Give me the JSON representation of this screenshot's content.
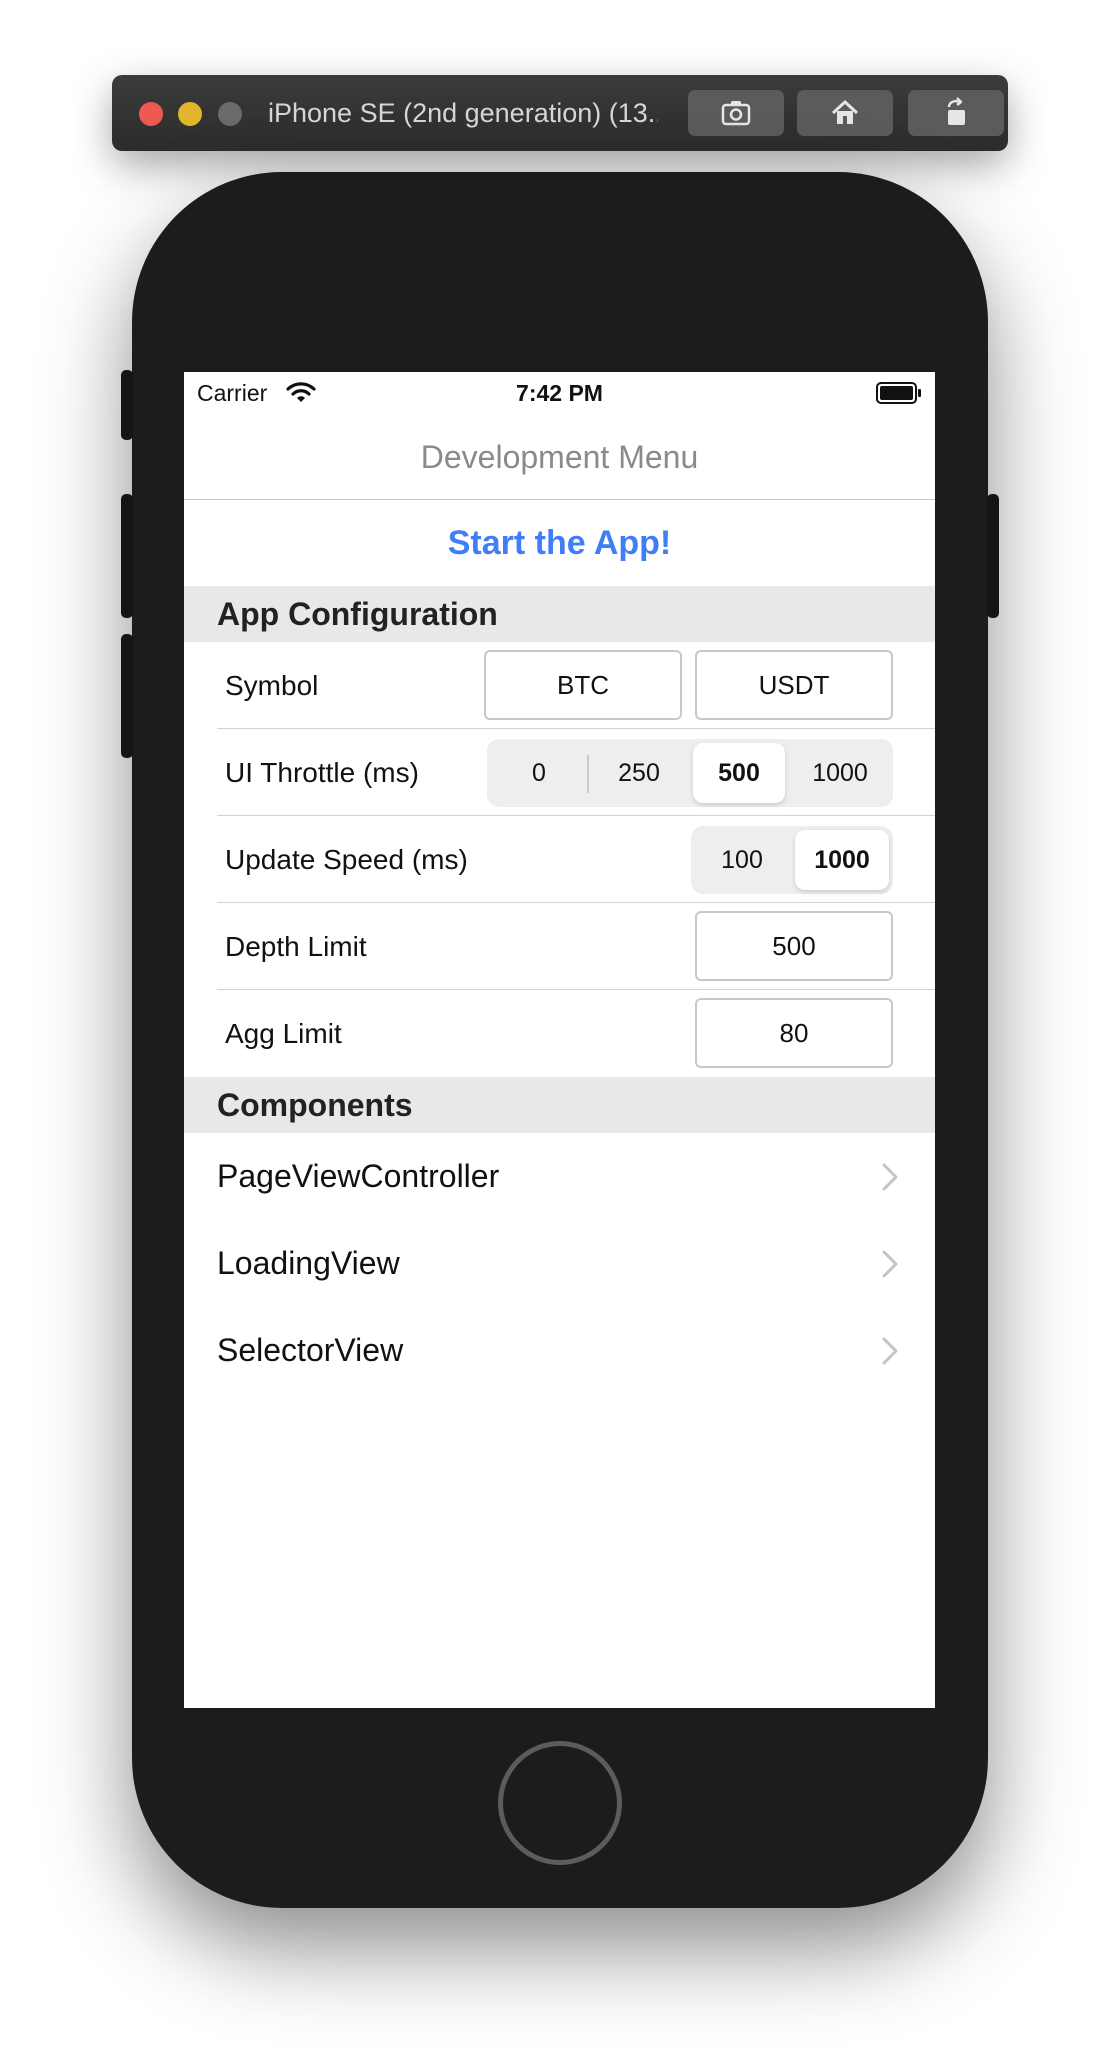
{
  "simulator": {
    "title": "iPhone SE (2nd generation) (13...",
    "buttons": [
      "screenshot-icon",
      "home-icon",
      "rotate-icon"
    ]
  },
  "status_bar": {
    "carrier": "Carrier",
    "time": "7:42 PM"
  },
  "nav": {
    "title": "Development Menu"
  },
  "start": {
    "label": "Start the App!"
  },
  "app_config": {
    "header": "App Configuration",
    "symbol": {
      "label": "Symbol",
      "base": "BTC",
      "quote": "USDT"
    },
    "ui_throttle": {
      "label": "UI Throttle (ms)",
      "options": [
        "0",
        "250",
        "500",
        "1000"
      ],
      "selected": "500"
    },
    "update_speed": {
      "label": "Update Speed (ms)",
      "options": [
        "100",
        "1000"
      ],
      "selected": "1000"
    },
    "depth_limit": {
      "label": "Depth Limit",
      "value": "500"
    },
    "agg_limit": {
      "label": "Agg Limit",
      "value": "80"
    }
  },
  "components": {
    "header": "Components",
    "items": [
      {
        "label": "PageViewController"
      },
      {
        "label": "LoadingView"
      },
      {
        "label": "SelectorView"
      }
    ]
  },
  "colors": {
    "accent": "#3f7ef6",
    "section_bg": "#e8e8e8",
    "device": "#1c1c1e"
  }
}
